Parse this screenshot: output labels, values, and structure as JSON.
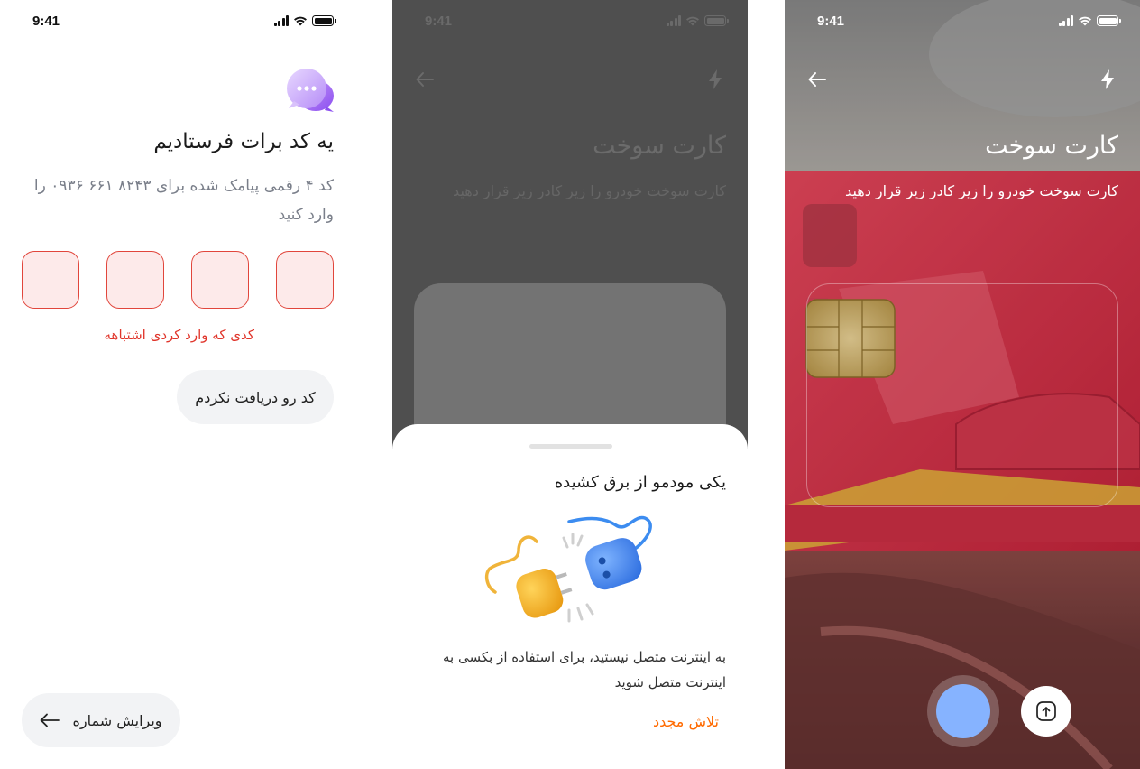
{
  "status_time": "9:41",
  "otp_screen": {
    "title": "یه کد برات فرستادیم",
    "description": "کد ۴ رقمی پیامک شده برای ۸۲۴۳ ۶۶۱ ۰۹۳۶ را وارد کنید",
    "error": "کدی که وارد کردی اشتباهه",
    "resend_label": "کد رو دریافت نکردم",
    "edit_number_label": "ویرایش شماره"
  },
  "offline_screen": {
    "title": "کارت سوخت",
    "subtitle": "کارت سوخت خودرو را زیر کادر زیر قرار دهید",
    "sheet_title": "یکی مودمو از برق کشیده",
    "sheet_description": "به اینترنت متصل نیستید، برای استفاده از بکسی به اینترنت متصل شوید",
    "retry_label": "تلاش مجدد"
  },
  "scan_screen": {
    "title": "کارت سوخت",
    "subtitle": "کارت سوخت خودرو را زیر کادر زیر قرار دهید"
  },
  "colors": {
    "error_red": "#e0352b",
    "retry_orange": "#ff6a00",
    "shutter_blue": "#86b3ff",
    "bubble_purple": "#a66ef5"
  },
  "icons": [
    "chat-bubble-icon",
    "arrow-left-icon",
    "flash-icon",
    "upload-icon",
    "unplugged-icon"
  ]
}
